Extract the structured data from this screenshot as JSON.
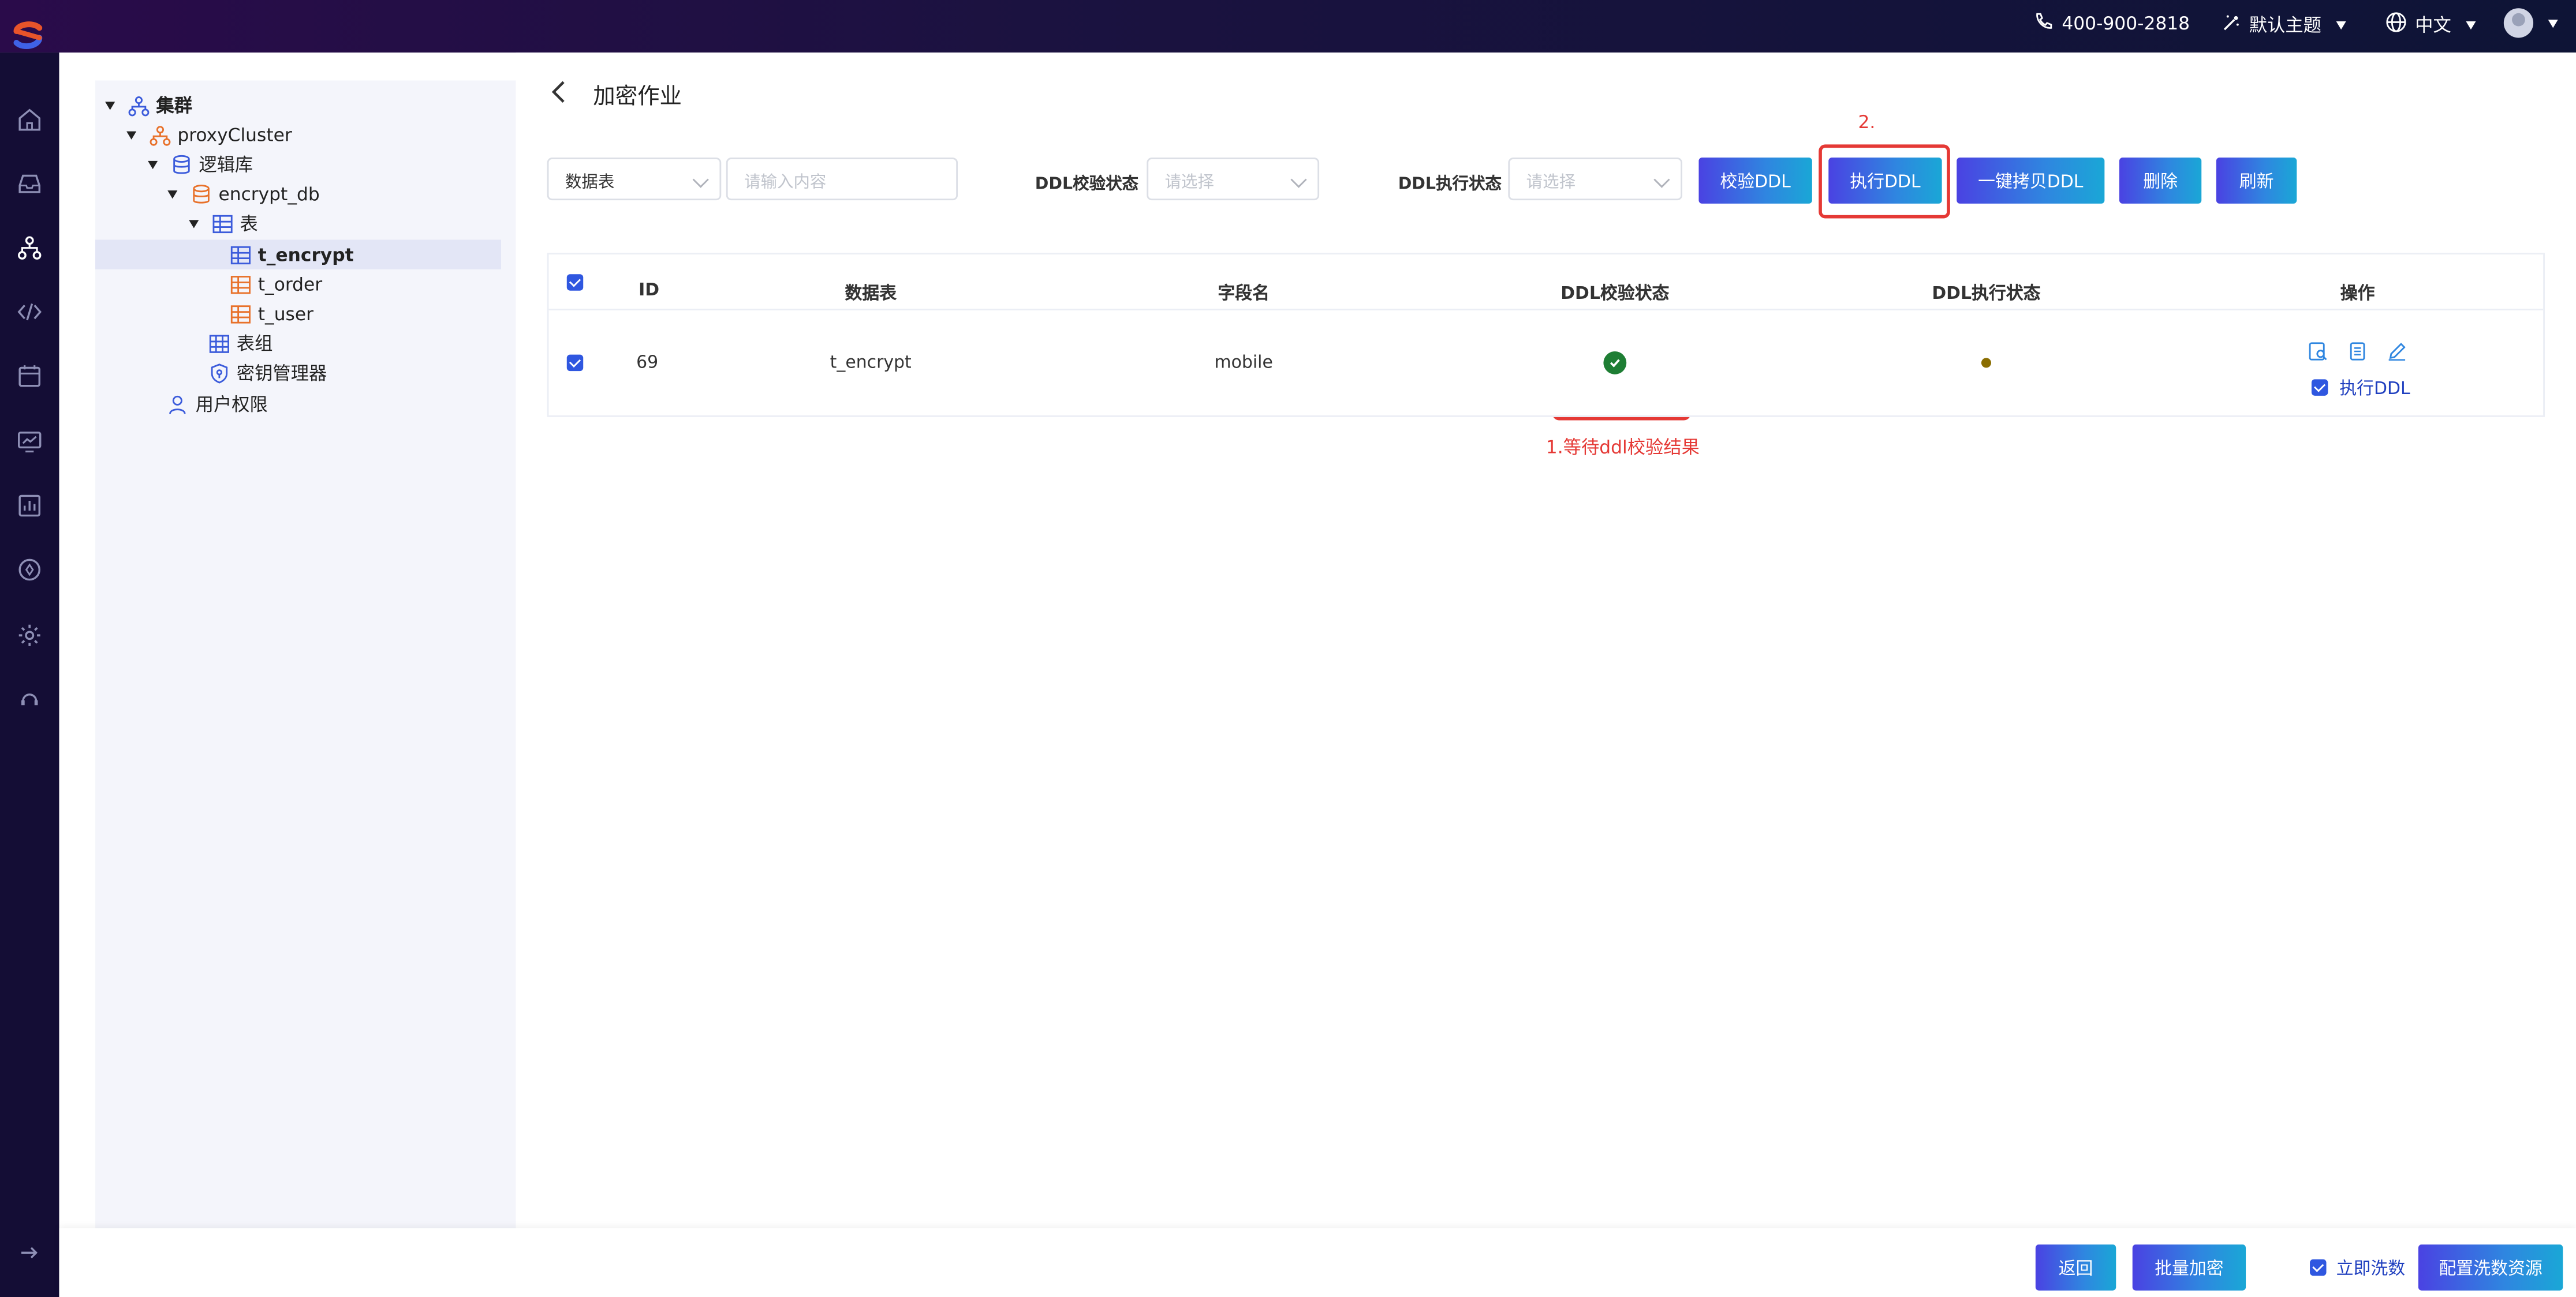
{
  "topbar": {
    "phone": "400-900-2818",
    "theme": "默认主题",
    "language": "中文"
  },
  "tree": {
    "items": [
      {
        "label": "集群",
        "icon": "cluster-icon"
      },
      {
        "label": "proxyCluster",
        "icon": "proxy-cluster-icon"
      },
      {
        "label": "逻辑库",
        "icon": "database-icon"
      },
      {
        "label": "encrypt_db",
        "icon": "database-icon"
      },
      {
        "label": "表",
        "icon": "table-icon"
      },
      {
        "label": "t_encrypt",
        "icon": "table-icon",
        "selected": true
      },
      {
        "label": "t_order",
        "icon": "table-icon"
      },
      {
        "label": "t_user",
        "icon": "table-icon"
      },
      {
        "label": "表组",
        "icon": "table-group-icon"
      },
      {
        "label": "密钥管理器",
        "icon": "key-manager-icon"
      },
      {
        "label": "用户权限",
        "icon": "user-icon"
      }
    ]
  },
  "page": {
    "title": "加密作业"
  },
  "filters": {
    "table_select": "数据表",
    "search_placeholder": "请输入内容",
    "ddl_check_label": "DDL校验状态",
    "ddl_check_placeholder": "请选择",
    "ddl_exec_label": "DDL执行状态",
    "ddl_exec_placeholder": "请选择"
  },
  "toolbar": {
    "check_ddl": "校验DDL",
    "exec_ddl": "执行DDL",
    "copy_ddl": "一键拷贝DDL",
    "delete": "删除",
    "refresh": "刷新"
  },
  "annotations": {
    "step2": "2.",
    "step1": "1.等待ddl校验结果"
  },
  "table": {
    "headers": [
      "ID",
      "数据表",
      "字段名",
      "DDL校验状态",
      "DDL执行状态",
      "操作"
    ],
    "rows": [
      {
        "id": "69",
        "table": "t_encrypt",
        "field": "mobile",
        "check_status": "success",
        "exec_status": "pending",
        "exec_ddl_label": "执行DDL",
        "exec_ddl_checked": true
      }
    ]
  },
  "footer": {
    "back": "返回",
    "batch_encrypt": "批量加密",
    "wash_now": "立即洗数",
    "config_wash": "配置洗数资源"
  },
  "colors": {
    "accent": "#3b5bdb",
    "success": "#1e7e34",
    "pending": "#8a6d00",
    "annotation": "#e53935"
  }
}
